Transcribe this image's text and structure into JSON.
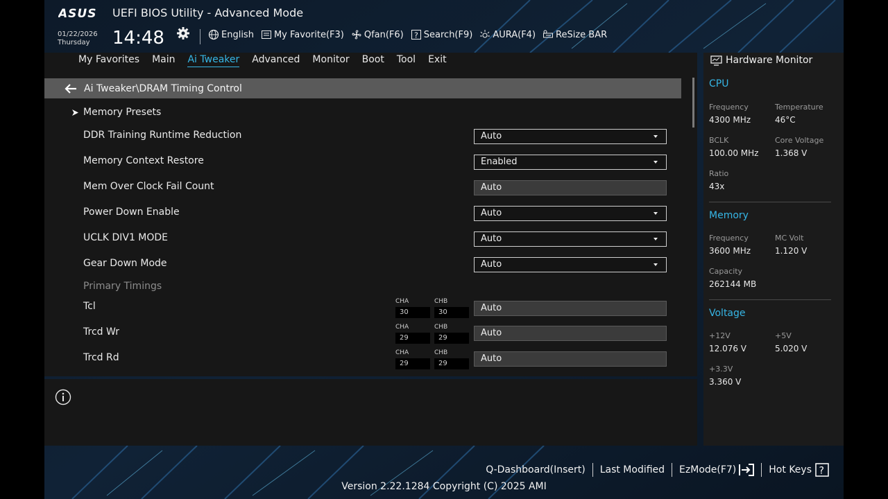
{
  "header": {
    "brand": "ASUS",
    "title": "UEFI BIOS Utility - Advanced Mode",
    "date": "01/22/2026",
    "weekday": "Thursday",
    "time": "14:48",
    "toolbar": [
      "English",
      "My Favorite(F3)",
      "Qfan(F6)",
      "Search(F9)",
      "AURA(F4)",
      "ReSize BAR"
    ]
  },
  "menu": {
    "tabs": [
      "My Favorites",
      "Main",
      "Ai Tweaker",
      "Advanced",
      "Monitor",
      "Boot",
      "Tool",
      "Exit"
    ],
    "active": "Ai Tweaker"
  },
  "breadcrumb": "Ai Tweaker\\DRAM Timing Control",
  "settings": {
    "presets": "Memory Presets",
    "rows": [
      {
        "label": "DDR Training Runtime Reduction",
        "value": "Auto",
        "type": "dropdown"
      },
      {
        "label": "Memory Context Restore",
        "value": "Enabled",
        "type": "dropdown"
      },
      {
        "label": "Mem Over Clock Fail Count",
        "value": "Auto",
        "type": "text"
      },
      {
        "label": "Power Down Enable",
        "value": "Auto",
        "type": "dropdown"
      },
      {
        "label": "UCLK DIV1 MODE",
        "value": "Auto",
        "type": "dropdown"
      },
      {
        "label": "Gear Down Mode",
        "value": "Auto",
        "type": "dropdown"
      }
    ],
    "subheader": "Primary Timings",
    "timings": [
      {
        "label": "Tcl",
        "cha": "30",
        "chb": "30",
        "value": "Auto"
      },
      {
        "label": "Trcd Wr",
        "cha": "29",
        "chb": "29",
        "value": "Auto"
      },
      {
        "label": "Trcd Rd",
        "cha": "29",
        "chb": "29",
        "value": "Auto"
      }
    ],
    "cha_label": "CHA",
    "chb_label": "CHB"
  },
  "hw": {
    "title": "Hardware Monitor",
    "cpu": {
      "title": "CPU",
      "freq_label": "Frequency",
      "freq": "4300 MHz",
      "temp_label": "Temperature",
      "temp": "46°C",
      "bclk_label": "BCLK",
      "bclk": "100.00 MHz",
      "vcore_label": "Core Voltage",
      "vcore": "1.368 V",
      "ratio_label": "Ratio",
      "ratio": "43x"
    },
    "memory": {
      "title": "Memory",
      "freq_label": "Frequency",
      "freq": "3600 MHz",
      "mcv_label": "MC Volt",
      "mcv": "1.120 V",
      "cap_label": "Capacity",
      "cap": "262144 MB"
    },
    "voltage": {
      "title": "Voltage",
      "v12_label": "+12V",
      "v12": "12.076 V",
      "v5_label": "+5V",
      "v5": "5.020 V",
      "v33_label": "+3.3V",
      "v33": "3.360 V"
    }
  },
  "footer": {
    "buttons": [
      "Q-Dashboard(Insert)",
      "Last Modified",
      "EzMode(F7)",
      "Hot Keys"
    ],
    "version": "Version 2.22.1284 Copyright (C) 2025 AMI"
  },
  "colors": {
    "accent": "#36b6e6",
    "panel": "#171717",
    "breadcrumb": "#5a5a5a"
  }
}
